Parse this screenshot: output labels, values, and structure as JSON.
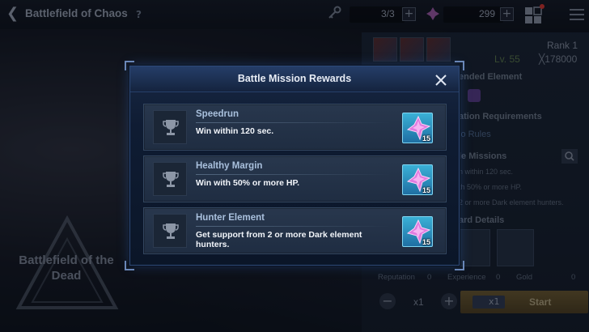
{
  "header": {
    "page_title": "Battlefield of Chaos",
    "help_icon": "question-icon",
    "keys_value": "3/3",
    "gems_value": "299"
  },
  "background": {
    "rank": "Rank 1",
    "level": "Lv. 55",
    "power": "╳178000",
    "recommended_element": "ended Element",
    "participation_requirements": "ation Requirements",
    "no_rules": "lo Rules",
    "battle_missions": "le Missions",
    "mission_line_1": "n within 120 sec.",
    "mission_line_2": "th 50% or more HP.",
    "mission_line_3": "2 or more Dark element hunters.",
    "reward_details": "ard Details",
    "reputation_label": "Reputation",
    "reputation_value": "0",
    "experience_label": "Experience",
    "experience_value": "0",
    "gold_label": "Gold",
    "gold_value": "0",
    "quantity": "x1",
    "start_key_count": "x1",
    "start_label": "Start",
    "stage_logo_title": "Battlefield of the Dead"
  },
  "modal": {
    "title": "Battle Mission Rewards",
    "close_icon": "close-icon",
    "missions": [
      {
        "title": "Speedrun",
        "description": "Win within 120 sec.",
        "reward_icon": "crystal-icon",
        "reward_count": "15"
      },
      {
        "title": "Healthy Margin",
        "description": "Win with 50% or more HP.",
        "reward_icon": "crystal-icon",
        "reward_count": "15"
      },
      {
        "title": "Hunter Element",
        "description": "Get support from 2 or more Dark element hunters.",
        "reward_icon": "crystal-icon",
        "reward_count": "15"
      }
    ]
  },
  "colors": {
    "modal_bg": "#0f1c33",
    "card_bg": "#28374d",
    "reward_tile": "#3ab0d6",
    "crystal": "#e07adf"
  }
}
